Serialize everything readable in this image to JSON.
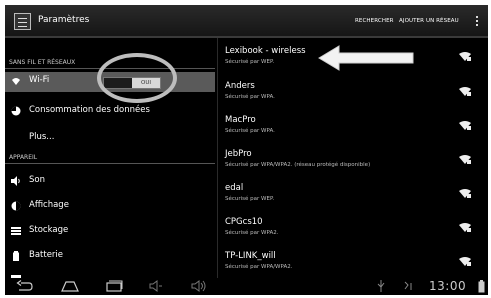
{
  "action_bar": {
    "title": "Paramètres",
    "search_label": "RECHERCHER",
    "add_network_label": "AJOUTER UN RÉSEAU"
  },
  "left_pane": {
    "section_wireless": "SANS FIL ET RÉSEAUX",
    "wifi_label": "Wi-Fi",
    "wifi_toggle_state": "OUI",
    "data_usage_label": "Consommation des données",
    "more_label": "Plus...",
    "section_device": "APPAREIL",
    "sound_label": "Son",
    "display_label": "Affichage",
    "storage_label": "Stockage",
    "battery_label": "Batterie"
  },
  "networks": [
    {
      "ssid": "Lexibook - wireless",
      "security": "Sécurisé par WEP."
    },
    {
      "ssid": "Anders",
      "security": "Sécurisé par WPA."
    },
    {
      "ssid": "MacPro",
      "security": "Sécurisé par WPA."
    },
    {
      "ssid": "JebPro",
      "security": "Sécurisé par WPA/WPA2. (réseau protégé disponible)"
    },
    {
      "ssid": "edal",
      "security": "Sécurisé par WEP."
    },
    {
      "ssid": "CPGcs10",
      "security": "Sécurisé par WPA2."
    },
    {
      "ssid": "TP-LINK_will",
      "security": "Sécurisé par WPA/WPA2."
    }
  ],
  "status_bar": {
    "clock": "13:00"
  },
  "icons": [
    "settings-app-icon",
    "overflow-menu-icon",
    "wifi-icon",
    "data-usage-icon",
    "sound-icon",
    "display-icon",
    "storage-icon",
    "battery-icon",
    "wifi-signal-lock-icon",
    "back-icon",
    "home-icon",
    "recent-apps-icon",
    "volume-down-icon",
    "volume-up-icon",
    "usb-icon",
    "sync-icon",
    "battery-status-icon"
  ],
  "colors": {
    "background": "#000000",
    "selected_item": "#5a5a5a",
    "text": "#ffffff",
    "annotation": "#bdbdbd"
  }
}
